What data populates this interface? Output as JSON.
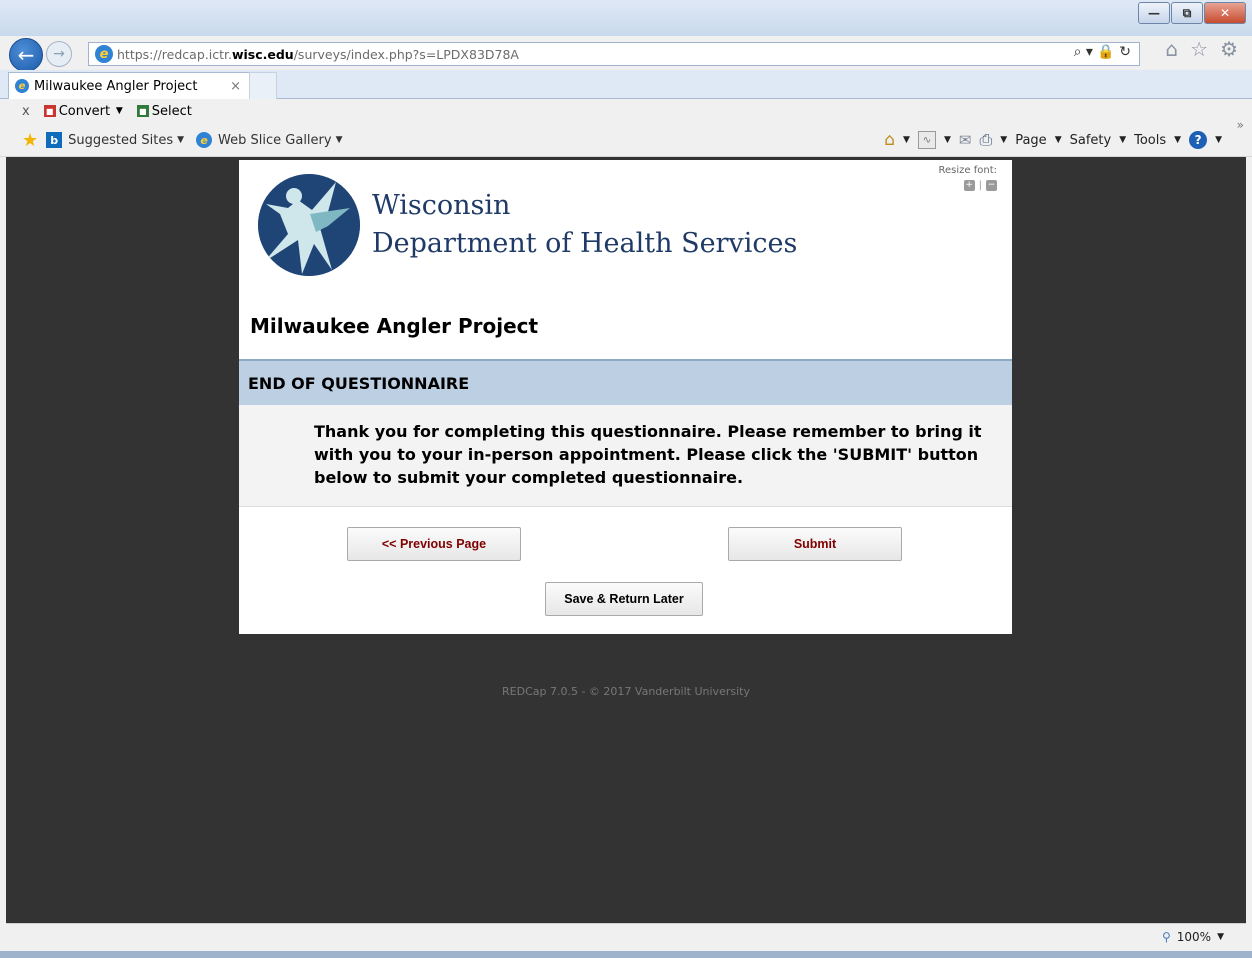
{
  "browser": {
    "url_prefix": "https://redcap.ictr.",
    "url_domain": "wisc.edu",
    "url_path": "/surveys/index.php?s=LPDX83D78A",
    "tab_title": "Milwaukee Angler Project",
    "tab_close": "×",
    "addr_tools": "⌕ ▾ 🔒 ↻",
    "win_minimize": "—",
    "win_restore": "⧉",
    "win_close": "✕"
  },
  "convert_toolbar": {
    "close": "x",
    "convert": "Convert",
    "select": "Select"
  },
  "favorites": {
    "suggested_sites": "Suggested Sites",
    "web_slice_gallery": "Web Slice Gallery"
  },
  "command_bar": {
    "page": "Page",
    "safety": "Safety",
    "tools": "Tools"
  },
  "survey": {
    "resize_font_label": "Resize font:",
    "resize_sep": "|",
    "org_line1": "Wisconsin",
    "org_line2": "Department of Health Services",
    "project_title": "Milwaukee Angler Project",
    "section_header": "END OF QUESTIONNAIRE",
    "question": "Thank you for completing this questionnaire. Please remember to bring it with you to your in-person appointment. Please click the 'SUBMIT' button below to submit your completed questionnaire.",
    "prev_button": "<< Previous Page",
    "submit_button": "Submit",
    "save_button": "Save & Return Later"
  },
  "footer": "REDCap 7.0.5 - © 2017 Vanderbilt University",
  "statusbar": {
    "zoom": "100%"
  },
  "colors": {
    "page_background": "#333333",
    "section_header": "#bccfe3",
    "button_text": "#800000",
    "org_text": "#1f3a66"
  }
}
